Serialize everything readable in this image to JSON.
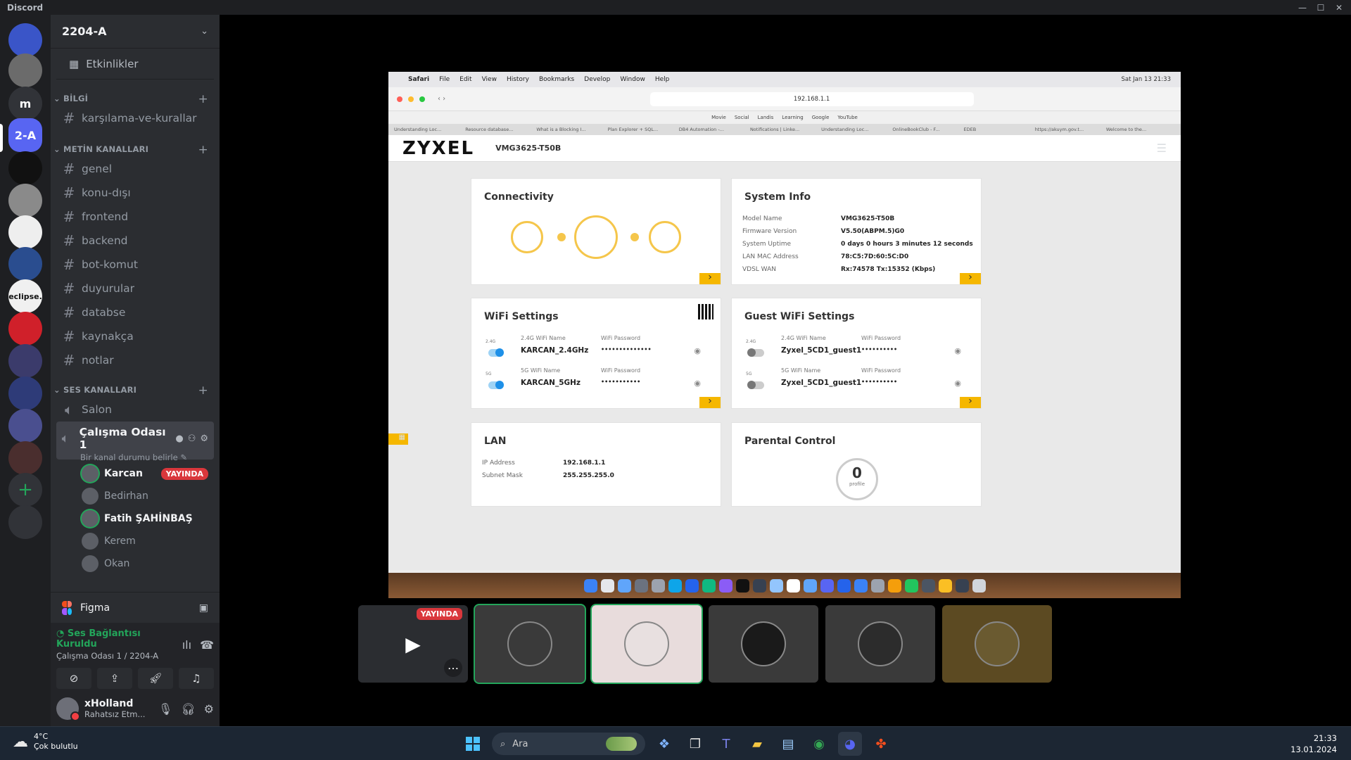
{
  "window": {
    "title": "Discord",
    "controls": [
      "—",
      "☐",
      "✕"
    ]
  },
  "servers": [
    {
      "initials": "",
      "color": "#3a55c8"
    },
    {
      "initials": "",
      "color": "#6b6b6b"
    },
    {
      "initials": "m",
      "color": "#313338"
    },
    {
      "initials": "2-A",
      "color": "#5865f2"
    },
    {
      "initials": "",
      "color": "#111111"
    },
    {
      "initials": "",
      "color": "#8a8a8a"
    },
    {
      "initials": "",
      "color": "#eeeeee"
    },
    {
      "initials": "",
      "color": "#2a4d8f"
    },
    {
      "initials": "eclipse.",
      "color": "#f0f0f0"
    },
    {
      "initials": "",
      "color": "#d0202a"
    },
    {
      "initials": "",
      "color": "#3b3b6b"
    },
    {
      "initials": "",
      "color": "#2e3b78"
    },
    {
      "initials": "",
      "color": "#4a4f8f"
    },
    {
      "initials": "",
      "color": "#4a2e2e"
    },
    {
      "initials": "+",
      "color": "#313338"
    },
    {
      "initials": "",
      "color": "#313338"
    }
  ],
  "guild": {
    "name": "2204-A",
    "events_label": "Etkinlikler"
  },
  "categories": {
    "info": "BİLGİ",
    "text": "METİN KANALLARI",
    "voice": "SES KANALLARI"
  },
  "info_channels": [
    "karşılama-ve-kurallar"
  ],
  "text_channels": [
    "genel",
    "konu-dışı",
    "frontend",
    "backend",
    "bot-komut",
    "duyurular",
    "databse",
    "kaynakça",
    "notlar"
  ],
  "voice_channels": {
    "salon": "Salon",
    "active": {
      "name": "Çalışma Odası 1",
      "status": "Bir kanal durumu belirle"
    },
    "members": [
      {
        "name": "Karcan",
        "live": "YAYINDA",
        "on": true
      },
      {
        "name": "Bedirhan",
        "live": "",
        "on": false
      },
      {
        "name": "Fatih ŞAHİNBAŞ",
        "live": "",
        "on": true
      },
      {
        "name": "Kerem",
        "live": "",
        "on": false
      },
      {
        "name": "Okan",
        "live": "",
        "on": false
      }
    ]
  },
  "activity": {
    "label": "Figma"
  },
  "voice_panel": {
    "status": "Ses Bağlantısı Kuruldu",
    "channel": "Çalışma Odası 1 / 2204-A"
  },
  "user": {
    "name": "xHolland",
    "status": "Rahatsız Etm..."
  },
  "stream": {
    "mac_menu": [
      "Safari",
      "File",
      "Edit",
      "View",
      "History",
      "Bookmarks",
      "Develop",
      "Window",
      "Help"
    ],
    "mac_clock": "Sat Jan 13  21:33",
    "url": "192.168.1.1",
    "favorites": [
      "Movie",
      "Social",
      "Landis",
      "Learning",
      "Google",
      "YouTube"
    ],
    "tabs": [
      "Understanding Loc...",
      "Resource database...",
      "What is a Blocking I...",
      "Plan Explorer + SQL...",
      "DB4 Automation -...",
      "Notifications | Linke...",
      "Understanding Loc...",
      "OnlineBookClub - F...",
      "EDEB",
      "https://akuym.gov.t...",
      "Welcome to the..."
    ],
    "brand": "ZYXEL",
    "model": "VMG3625-T50B",
    "connectivity": {
      "title": "Connectivity"
    },
    "system_info": {
      "title": "System Info",
      "rows": [
        {
          "k": "Model Name",
          "v": "VMG3625-T50B"
        },
        {
          "k": "Firmware Version",
          "v": "V5.50(ABPM.5)G0"
        },
        {
          "k": "System Uptime",
          "v": "0 days 0 hours 3 minutes 12 seconds"
        },
        {
          "k": "LAN MAC Address",
          "v": "78:C5:7D:60:5C:D0"
        },
        {
          "k": "VDSL WAN",
          "v": "Rx:74578 Tx:15352 (Kbps)"
        }
      ]
    },
    "wifi": {
      "title": "WiFi Settings",
      "name24_label": "2.4G WiFi Name",
      "name5_label": "5G WiFi Name",
      "pw_label": "WiFi Password",
      "name24": "KARCAN_2.4GHz",
      "name5": "KARCAN_5GHz",
      "pw24": "••••••••••••••",
      "pw5": "•••••••••••",
      "band24": "2.4G",
      "band5": "5G"
    },
    "guest": {
      "title": "Guest WiFi Settings",
      "name24_label": "2.4G WiFi Name",
      "name5_label": "5G WiFi Name",
      "pw_label": "WiFi Password",
      "name24": "Zyxel_5CD1_guest1",
      "name5": "Zyxel_5CD1_guest1",
      "pw24": "••••••••••",
      "pw5": "••••••••••",
      "band24": "2.4G",
      "band5": "5G"
    },
    "lan": {
      "title": "LAN",
      "rows": [
        {
          "k": "IP Address",
          "v": "192.168.1.1"
        },
        {
          "k": "Subnet Mask",
          "v": "255.255.255.0"
        }
      ]
    },
    "parental": {
      "title": "Parental Control",
      "count": "0",
      "unit": "profile"
    }
  },
  "tiles": [
    {
      "kind": "screen",
      "live": "YAYINDA"
    },
    {
      "kind": "avatar",
      "color": "#3a3a3a"
    },
    {
      "kind": "avatar",
      "color": "#e8e0e0"
    },
    {
      "kind": "avatar",
      "color": "#1a1a1a"
    },
    {
      "kind": "avatar",
      "color": "#2c2c2c"
    },
    {
      "kind": "avatar",
      "color": "#6a5a30"
    }
  ],
  "taskbar": {
    "weather_temp": "4°C",
    "weather_desc": "Çok bulutlu",
    "search_placeholder": "Ara",
    "time": "21:33",
    "date": "13.01.2024"
  }
}
